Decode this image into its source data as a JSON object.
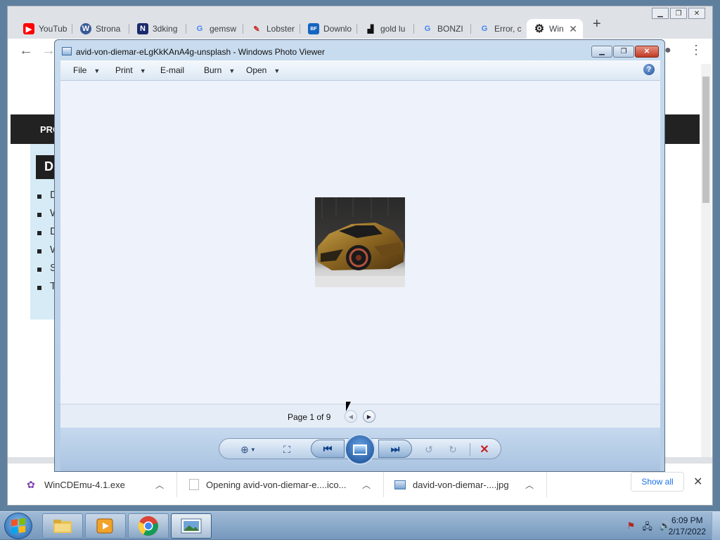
{
  "browser": {
    "tabs": [
      {
        "label": "YouTub",
        "icon": "youtube-icon",
        "color": "#ff0000"
      },
      {
        "label": "Strona",
        "icon": "wordpress-icon",
        "color": "#3b5998"
      },
      {
        "label": "3dking",
        "icon": "3dkings-icon",
        "color": "#1b2a6b"
      },
      {
        "label": "gemsw",
        "icon": "google-icon",
        "color": "#4285f4"
      },
      {
        "label": "Lobster",
        "icon": "lobster-icon",
        "color": "#c62828"
      },
      {
        "label": "Downlo",
        "icon": "bigfish-icon",
        "color": "#1565c0"
      },
      {
        "label": "gold lu",
        "icon": "person-icon",
        "color": "#111111"
      },
      {
        "label": "BONZI",
        "icon": "google-icon",
        "color": "#4285f4"
      },
      {
        "label": "Error, c",
        "icon": "google-icon",
        "color": "#4285f4"
      },
      {
        "label": "Win",
        "icon": "gear-icon",
        "color": "#222222"
      }
    ],
    "page": {
      "dark_bar_text": "PRO",
      "heading_text": "D",
      "bullets": [
        "D",
        "D",
        "S",
        "T"
      ],
      "bullet_continuations": [
        "W",
        "W"
      ]
    },
    "downloads": [
      {
        "name": "WinCDEmu-4.1.exe",
        "icon": "wincdemu-icon"
      },
      {
        "name": "Opening avid-von-diemar-e....ico...",
        "icon": "file-icon"
      },
      {
        "name": "david-von-diemar-....jpg",
        "icon": "image-icon"
      }
    ],
    "show_all_label": "Show all"
  },
  "photo_viewer": {
    "title": "avid-von-diemar-eLgKkKAnA4g-unsplash - Windows Photo Viewer",
    "menu": [
      "File",
      "Print",
      "E-mail",
      "Burn",
      "Open"
    ],
    "page_info": "Page 1 of 9"
  },
  "taskbar": {
    "time": "6:09 PM",
    "date": "2/17/2022",
    "apps": [
      "file-explorer-icon",
      "media-player-icon",
      "chrome-icon",
      "photo-viewer-icon"
    ]
  }
}
